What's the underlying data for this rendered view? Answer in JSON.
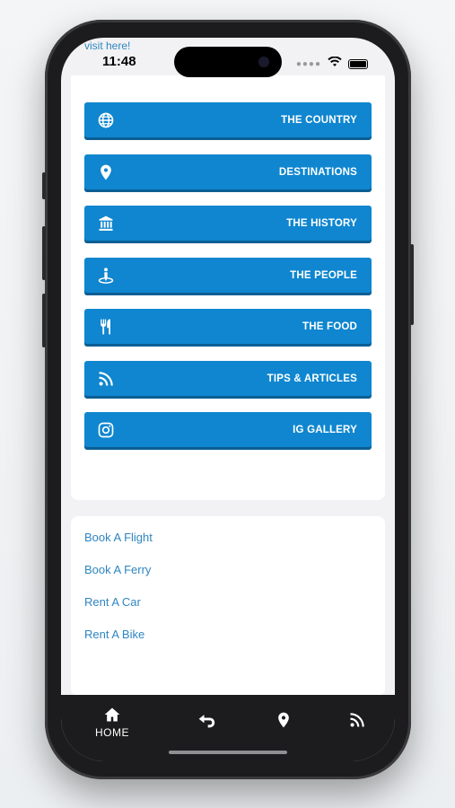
{
  "status": {
    "link_text": "visit here!",
    "time": "11:48"
  },
  "menu": [
    {
      "label": "THE COUNTRY",
      "icon": "globe-icon"
    },
    {
      "label": "DESTINATIONS",
      "icon": "map-pin-icon"
    },
    {
      "label": "THE HISTORY",
      "icon": "museum-icon"
    },
    {
      "label": "THE PEOPLE",
      "icon": "person-pin-icon"
    },
    {
      "label": "THE FOOD",
      "icon": "fork-knife-icon"
    },
    {
      "label": "TIPS & ARTICLES",
      "icon": "rss-icon"
    },
    {
      "label": "IG GALLERY",
      "icon": "instagram-icon"
    }
  ],
  "links": [
    "Book A Flight",
    "Book A Ferry",
    "Rent A Car",
    "Rent A Bike"
  ],
  "tabbar": {
    "home_label": "HOME",
    "icons": [
      "home-icon",
      "back-arrow-icon",
      "map-pin-icon",
      "rss-icon"
    ]
  },
  "colors": {
    "accent": "#0f86cf",
    "link": "#2e86c1",
    "tabbar": "#1c1c1e"
  }
}
